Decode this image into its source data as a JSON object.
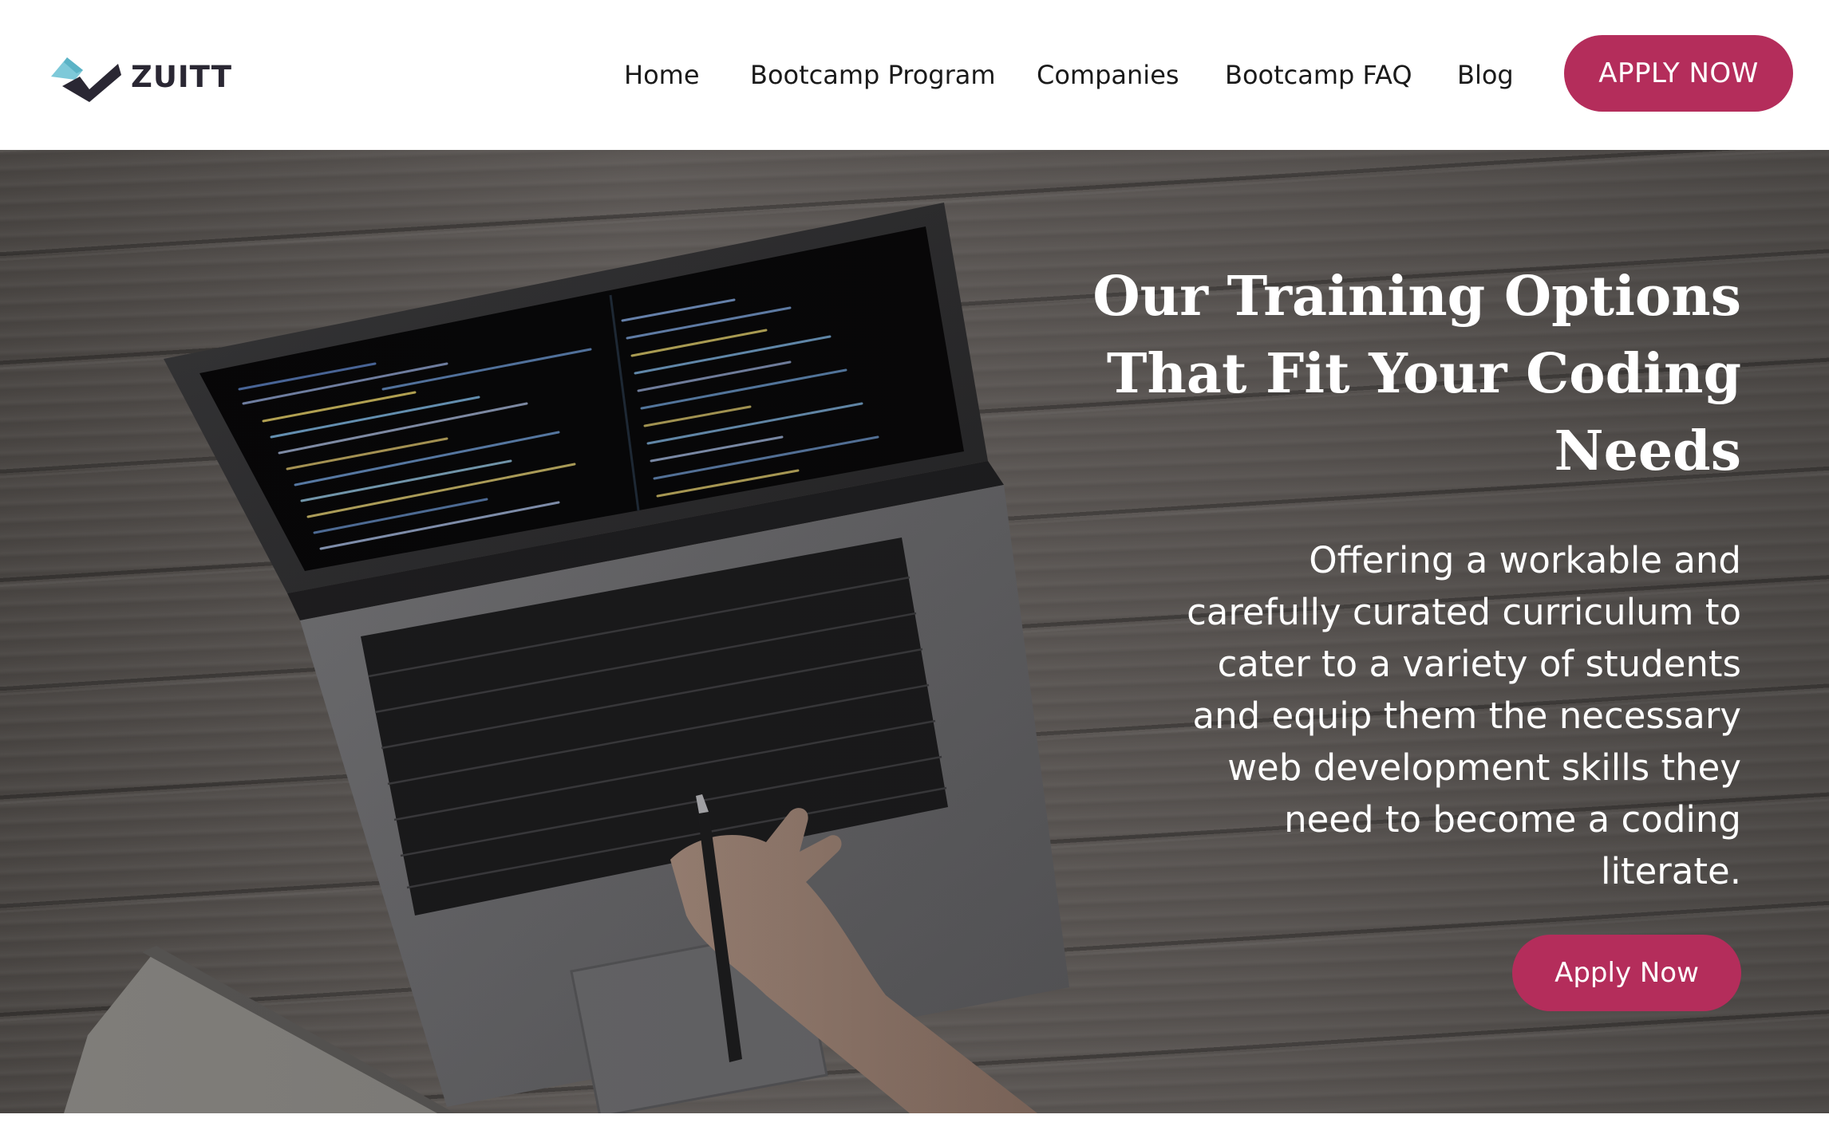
{
  "brand": {
    "name": "ZUITT",
    "colors": {
      "accent": "#b42d5b",
      "logo_teal": "#6cc3d5",
      "logo_dark": "#2a2733"
    }
  },
  "nav": {
    "items": [
      {
        "label": "Home"
      },
      {
        "label": "Bootcamp Program"
      },
      {
        "label": "Companies"
      },
      {
        "label": "Bootcamp FAQ"
      },
      {
        "label": "Blog"
      }
    ],
    "cta_label": "APPLY NOW"
  },
  "hero": {
    "title_lines": [
      "Our Training Options",
      "That Fit Your Coding",
      "Needs"
    ],
    "description_lines": [
      "Offering a workable and",
      "carefully curated curriculum to",
      "cater to a variety of students",
      "and equip them the necessary",
      "web development skills they",
      "need to become a coding",
      "literate."
    ],
    "cta_label": "Apply Now",
    "image": "laptop-on-wooden-desk-photo"
  }
}
